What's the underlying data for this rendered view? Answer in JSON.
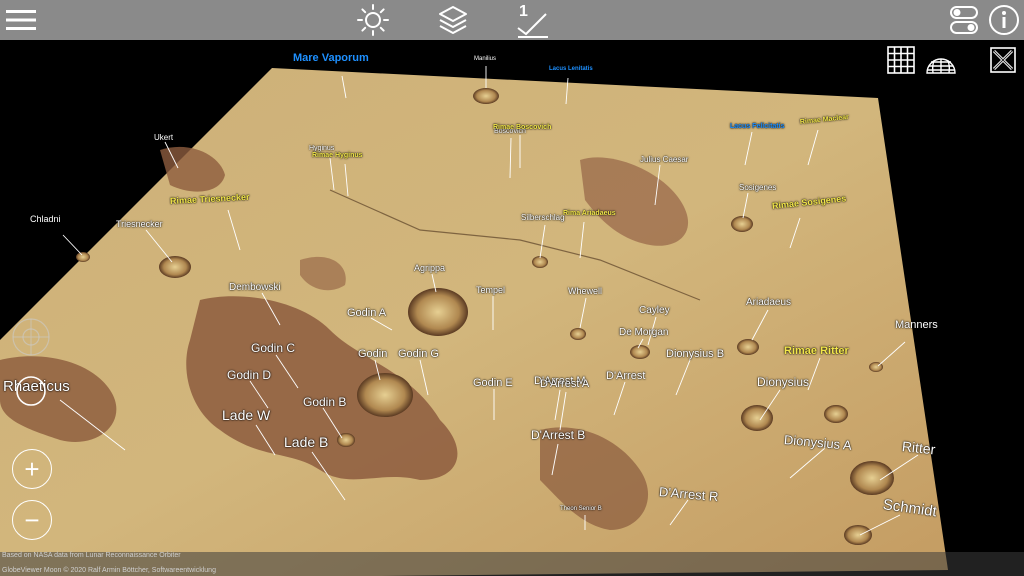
{
  "toolbar": {
    "menu_icon": "menu-icon",
    "lighting_icon": "sun-icon",
    "layers_icon": "layers-icon",
    "scale_icon": "elevation-scale-icon",
    "scale_value": "1",
    "settings_icon": "toggle-settings-icon",
    "info_icon": "info-icon"
  },
  "view_controls": {
    "grid_icon": "grid-icon",
    "globe_icon": "globe-icon",
    "exaggeration_icon": "close-x-icon",
    "zoom_in": "+",
    "zoom_out": "−",
    "nav_icon": "navigation-pad-icon",
    "rotate_icon": "rotate-icon"
  },
  "labels": [
    {
      "text": "Mare Vaporum",
      "color": "b"
    },
    {
      "text": "Manilius",
      "color": "w"
    },
    {
      "text": "Lacus Lenitatis",
      "color": "b"
    },
    {
      "text": "Ukert",
      "color": "w"
    },
    {
      "text": "Hyginus",
      "color": "w"
    },
    {
      "text": "Rimae Hyginus",
      "color": "y"
    },
    {
      "text": "Boscovich",
      "color": "w"
    },
    {
      "text": "Rimae Boscovich",
      "color": "y"
    },
    {
      "text": "Julius Caesar",
      "color": "w"
    },
    {
      "text": "Lacus Felicitatis",
      "color": "b"
    },
    {
      "text": "Rimae Maclear",
      "color": "y"
    },
    {
      "text": "Rimae Triesnecker",
      "color": "y"
    },
    {
      "text": "Sosigenes",
      "color": "w"
    },
    {
      "text": "Chladni",
      "color": "w"
    },
    {
      "text": "Triesnecker",
      "color": "w"
    },
    {
      "text": "Silberschlag",
      "color": "w"
    },
    {
      "text": "Rima Ariadaeus",
      "color": "y"
    },
    {
      "text": "Rimae Sosigenes",
      "color": "y"
    },
    {
      "text": "Agrippa",
      "color": "w"
    },
    {
      "text": "Dembowski",
      "color": "w"
    },
    {
      "text": "Tempel",
      "color": "w"
    },
    {
      "text": "Whewell",
      "color": "w"
    },
    {
      "text": "Ariadaeus",
      "color": "w"
    },
    {
      "text": "Cayley",
      "color": "w"
    },
    {
      "text": "Godin A",
      "color": "w"
    },
    {
      "text": "De Morgan",
      "color": "w"
    },
    {
      "text": "Manners",
      "color": "w"
    },
    {
      "text": "Godin C",
      "color": "w"
    },
    {
      "text": "Dionysius B",
      "color": "w"
    },
    {
      "text": "Rimae Ritter",
      "color": "y"
    },
    {
      "text": "Godin",
      "color": "w"
    },
    {
      "text": "Godin G",
      "color": "w"
    },
    {
      "text": "D'Arrest",
      "color": "w"
    },
    {
      "text": "Godin D",
      "color": "w"
    },
    {
      "text": "Godin E",
      "color": "w"
    },
    {
      "text": "D'Arrest M",
      "color": "w"
    },
    {
      "text": "Dionysius",
      "color": "w"
    },
    {
      "text": "Rhaeticus",
      "color": "w"
    },
    {
      "text": "Godin B",
      "color": "w"
    },
    {
      "text": "Lade W",
      "color": "w"
    },
    {
      "text": "D'Arrest A",
      "color": "w"
    },
    {
      "text": "Lade B",
      "color": "w"
    },
    {
      "text": "D'Arrest B",
      "color": "w"
    },
    {
      "text": "Dionysius A",
      "color": "w"
    },
    {
      "text": "Ritter",
      "color": "w"
    },
    {
      "text": "D'Arrest R",
      "color": "w"
    },
    {
      "text": "Schmidt",
      "color": "w"
    },
    {
      "text": "Theon Senior B",
      "color": "w"
    }
  ],
  "footer": {
    "line1": "Based on NASA data from Lunar Reconnaissance Orbiter",
    "line2": "GlobeViewer Moon © 2020 Ralf Armin Böttcher, Softwareentwicklung"
  }
}
